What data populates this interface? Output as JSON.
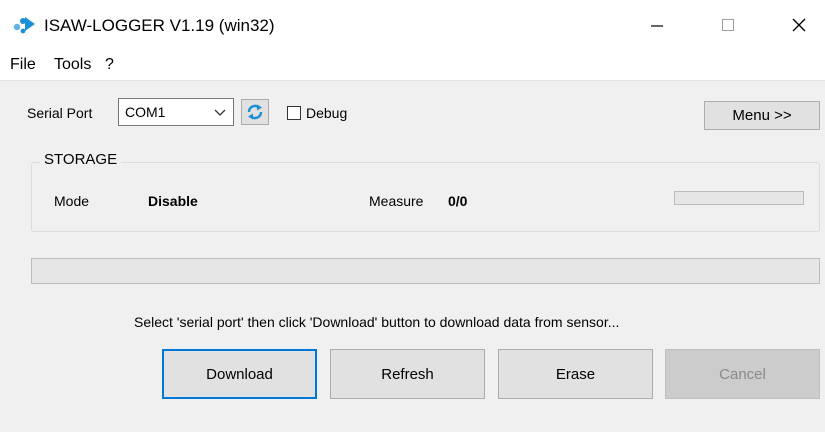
{
  "window": {
    "title": "ISAW-LOGGER V1.19 (win32)"
  },
  "menu": [
    "File",
    "Tools",
    "?"
  ],
  "serial": {
    "label": "Serial Port",
    "port": "COM1",
    "debug_label": "Debug",
    "debug_checked": false
  },
  "menu_button": "Menu >>",
  "storage": {
    "title": "STORAGE",
    "mode_label": "Mode",
    "mode_value": "Disable",
    "measure_label": "Measure",
    "measure_value": "0/0",
    "progress": 0
  },
  "main_progress": 0,
  "status_text": "Select 'serial port' then click 'Download' button to download data from sensor...",
  "buttons": {
    "download": "Download",
    "refresh": "Refresh",
    "erase": "Erase",
    "cancel": "Cancel"
  },
  "icons": {
    "app": "isaw-app-icon",
    "refresh": "refresh-arrows-icon",
    "minimize": "minimize-icon",
    "maximize": "maximize-icon",
    "close": "close-icon",
    "dropdown": "chevron-down-icon"
  },
  "colors": {
    "accent": "#0078d7",
    "progress_fill": "#06b025",
    "app_icon": "#1a8fd6"
  }
}
